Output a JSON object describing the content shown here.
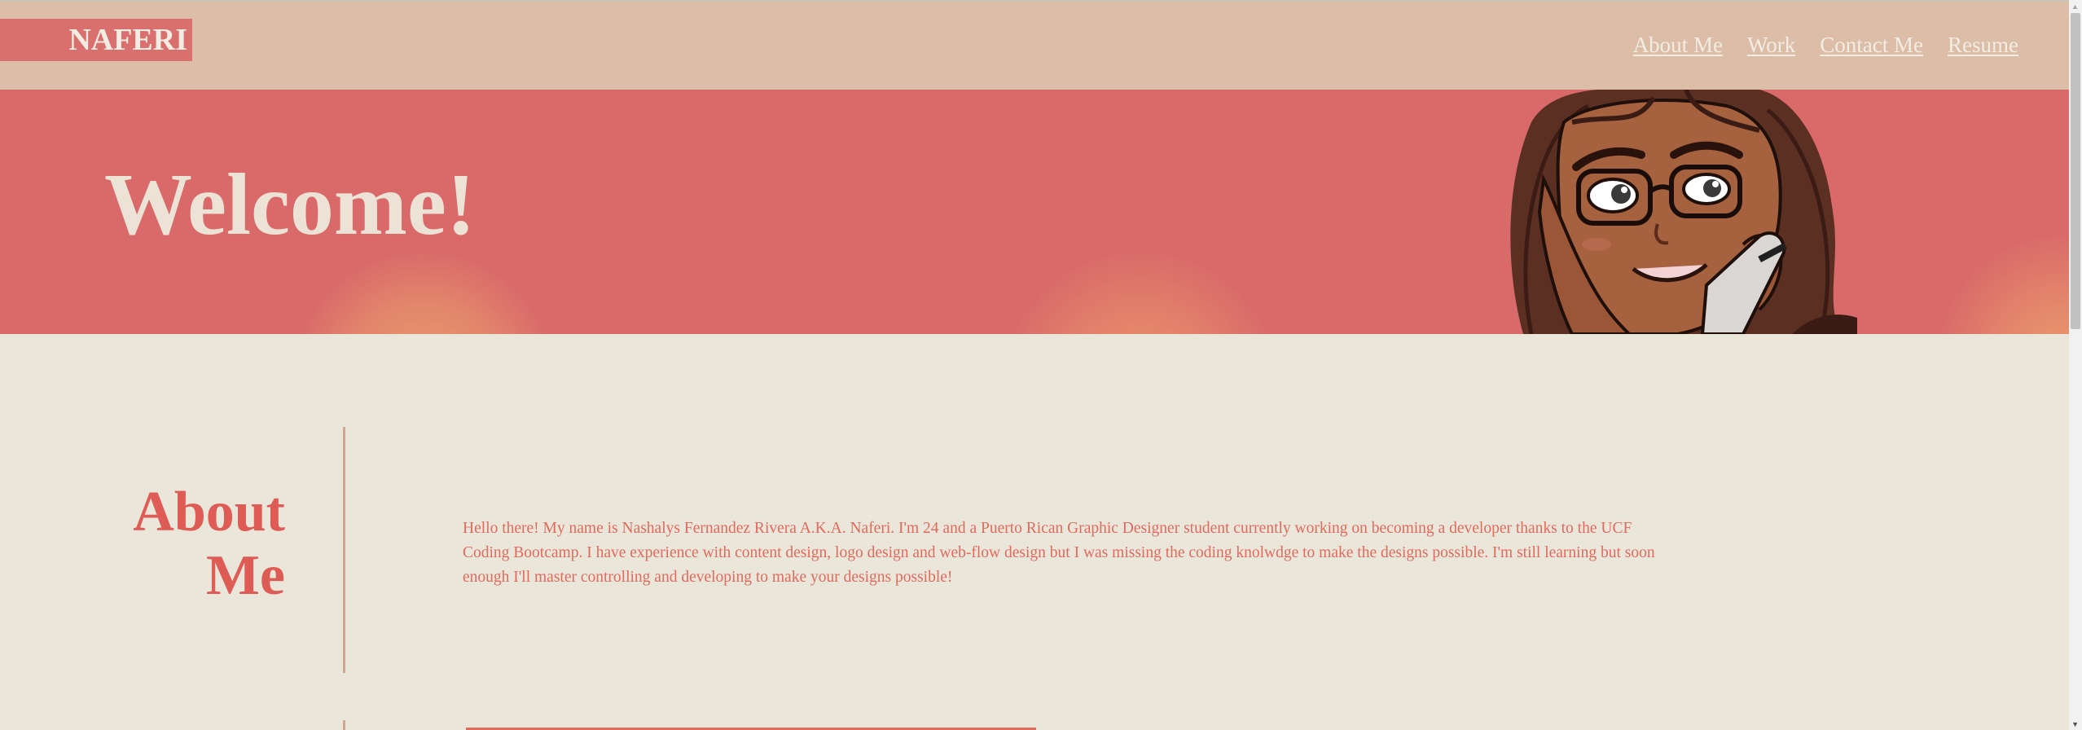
{
  "header": {
    "logo": "NAFERI",
    "nav": [
      "About Me",
      "Work",
      "Contact Me",
      "Resume"
    ]
  },
  "hero": {
    "title": "Welcome!"
  },
  "about": {
    "title_line1": "About",
    "title_line2": "Me",
    "text": "Hello there! My name is Nashalys Fernandez Rivera A.K.A. Naferi. I'm 24 and a Puerto Rican Graphic Designer student currently working on becoming a developer thanks to the UCF Coding Bootcamp. I have experience with content design, logo design and web-flow design but I was missing the coding knolwdge to make the designs possible. I'm still learning but soon enough I'll master controlling and developing to make your designs possible!"
  },
  "colors": {
    "header_bg": "#dcbea8",
    "hero_bg": "#d96a69",
    "page_bg": "#eae6da",
    "accent": "#df5b56",
    "logo_bg": "#d9706e",
    "light_text": "#f3ece2"
  },
  "icons": [
    "avatar-illustration",
    "scroll-up-arrow-icon",
    "scroll-down-arrow-icon"
  ]
}
